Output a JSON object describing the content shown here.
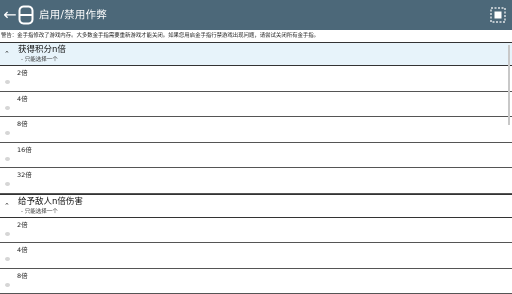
{
  "appbar": {
    "title": "启用/禁用作弊",
    "back_icon": "arrow-left-icon",
    "app_icon": "cheat-app-icon",
    "menu_icon": "select-all-icon"
  },
  "warning": "警告：金手指修改了游戏内存。大多数金手指需要重新游戏才能关闭。如果您用启金手指行禁游戏出现问题，请尝试关闭所有金手指。",
  "groups": [
    {
      "title": "获得积分n倍",
      "subtitle": "- 只能选择一个",
      "items": [
        "2倍",
        "4倍",
        "8倍",
        "16倍",
        "32倍"
      ]
    },
    {
      "title": "给予敌人n倍伤害",
      "subtitle": "- 只能选择一个",
      "items": [
        "2倍",
        "4倍",
        "8倍"
      ]
    }
  ],
  "colors": {
    "appbar": "#4c6879",
    "group_header_highlight": "#e7f3fa"
  }
}
